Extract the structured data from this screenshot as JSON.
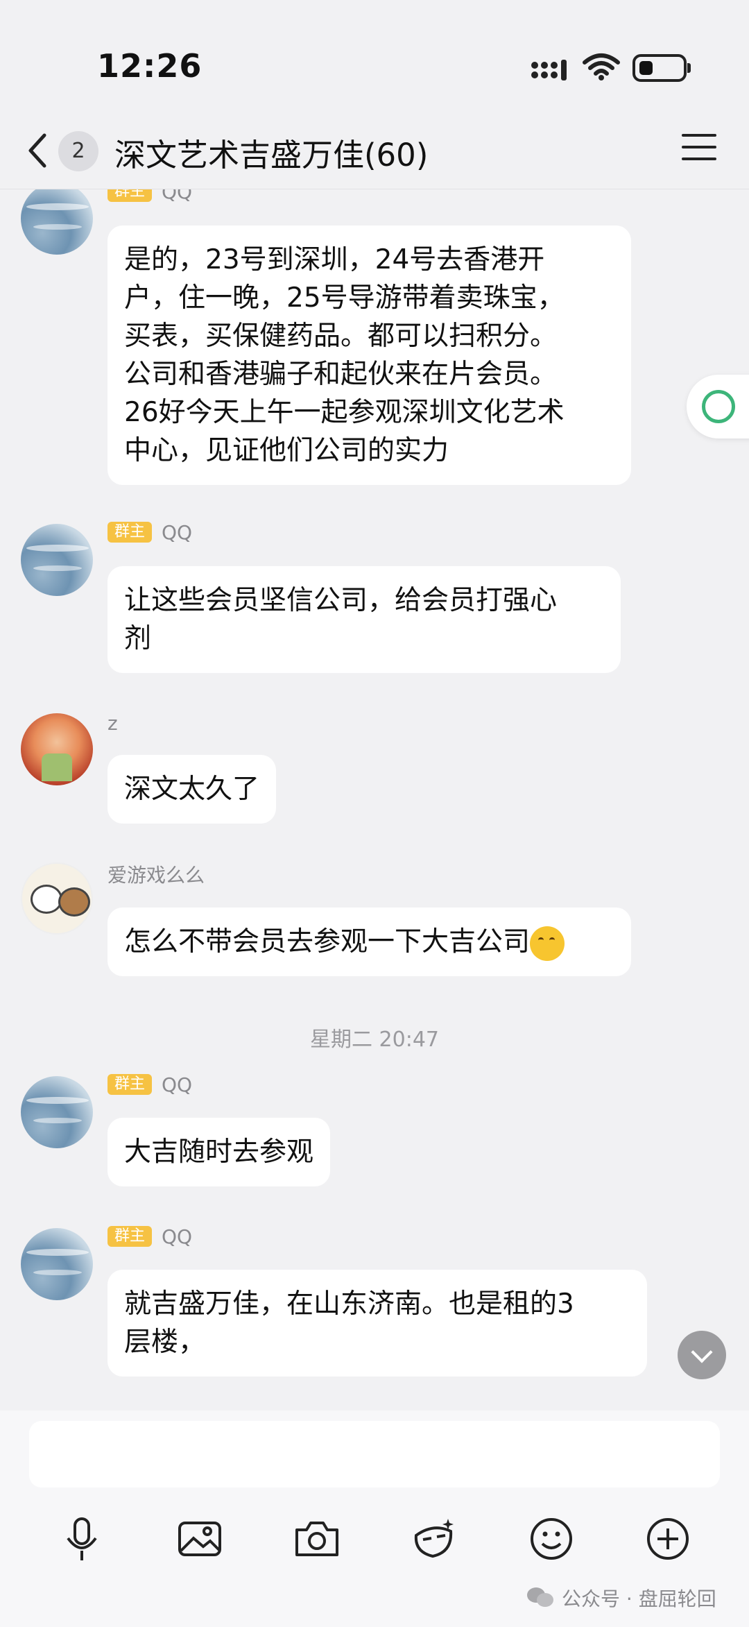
{
  "status_bar": {
    "time": "12:26",
    "battery_level": 0.3
  },
  "header": {
    "back_icon": "chevron-left-icon",
    "unread_count": "2",
    "title": "深文艺术吉盛万佳(60)",
    "menu_icon": "hamburger-menu-icon"
  },
  "messages": [
    {
      "sender": "QQ",
      "badge": "群主",
      "avatar": "sea-avatar",
      "text": [
        "是的，23号到深圳，24号去香港开",
        "户，住一晚，25号导游带着卖珠宝，",
        "买表，买保健药品。都可以扫积分。",
        "公司和香港骗子和起伙来在片会员。",
        "26好今天上午一起参观深圳文化艺术",
        "中心，见证他们公司的实力"
      ]
    },
    {
      "sender": "QQ",
      "badge": "群主",
      "avatar": "sea-avatar",
      "text": [
        "让这些会员坚信公司，给会员打强心",
        "剂"
      ]
    },
    {
      "sender": "z",
      "avatar": "girl-avatar",
      "text": [
        "深文太久了"
      ]
    },
    {
      "sender": "爱游戏么么",
      "avatar": "bear-avatar",
      "text": [
        "怎么不带会员去参观一下大吉公司"
      ],
      "emoji": "grinning-face-emoji"
    },
    {
      "timestamp": "星期二 20:47"
    },
    {
      "sender": "QQ",
      "badge": "群主",
      "avatar": "sea-avatar",
      "text": [
        "大吉随时去参观"
      ]
    },
    {
      "sender": "QQ",
      "badge": "群主",
      "avatar": "sea-avatar",
      "text": [
        "就吉盛万佳，在山东济南。也是租的3",
        "层楼，"
      ]
    }
  ],
  "toolbar": {
    "icons": [
      "microphone-icon",
      "image-icon",
      "camera-icon",
      "sticker-icon",
      "emoji-icon",
      "plus-icon"
    ]
  },
  "watermark": "公众号 · 盘屈轮回",
  "colors": {
    "background": "#f1f1f3",
    "bubble": "#ffffff",
    "owner_badge": "#f6c243",
    "accent_green": "#3db57a"
  }
}
